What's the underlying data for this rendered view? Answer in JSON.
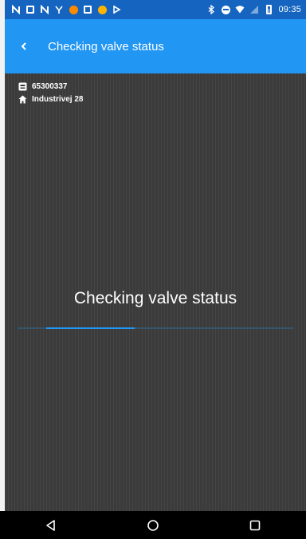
{
  "status_bar": {
    "time": "09:35",
    "icons_left": [
      "n-icon",
      "message-icon",
      "n-icon",
      "antenna-icon",
      "orange-app-icon",
      "square-icon",
      "yellow-app-icon",
      "cast-icon"
    ],
    "icons_right": [
      "bluetooth-icon",
      "do-not-disturb-icon",
      "wifi-icon",
      "signal-icon",
      "battery-icon"
    ],
    "colors": {
      "background": "#1565c0",
      "foreground": "#ffffff"
    }
  },
  "app_bar": {
    "title": "Checking valve status",
    "back_icon": "back-chevron-icon",
    "color": "#2196f3"
  },
  "meter": {
    "number": "65300337",
    "address": "Industrivej 28",
    "number_icon": "meter-icon",
    "address_icon": "home-icon"
  },
  "status": {
    "message": "Checking valve status",
    "progress": 0.32
  },
  "navigation": {
    "buttons": [
      "back-nav-icon",
      "home-nav-icon",
      "recents-nav-icon"
    ]
  }
}
